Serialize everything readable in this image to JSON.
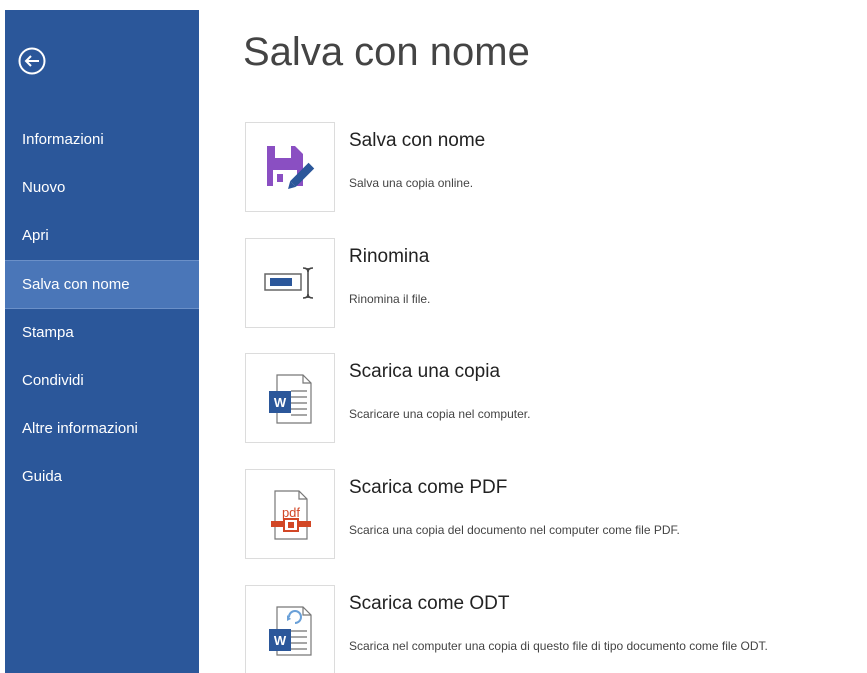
{
  "sidebar": {
    "back_icon": "back-arrow-circle-icon",
    "items": [
      {
        "label": "Informazioni",
        "active": false
      },
      {
        "label": "Nuovo",
        "active": false
      },
      {
        "label": "Apri",
        "active": false
      },
      {
        "label": "Salva con nome",
        "active": true
      },
      {
        "label": "Stampa",
        "active": false
      },
      {
        "label": "Condividi",
        "active": false
      },
      {
        "label": "Altre informazioni",
        "active": false
      },
      {
        "label": "Guida",
        "active": false
      }
    ]
  },
  "main": {
    "title": "Salva con nome",
    "options": [
      {
        "title": "Salva con nome",
        "description": "Salva una copia online.",
        "icon": "save-as-icon"
      },
      {
        "title": "Rinomina",
        "description": "Rinomina il file.",
        "icon": "rename-icon"
      },
      {
        "title": "Scarica una copia",
        "description": "Scaricare una copia nel computer.",
        "icon": "word-document-icon"
      },
      {
        "title": "Scarica come PDF",
        "description": "Scarica una copia del documento nel computer come file PDF.",
        "icon": "pdf-icon"
      },
      {
        "title": "Scarica come ODT",
        "description": "Scarica nel computer una copia di questo file di tipo documento come file ODT.",
        "icon": "odt-document-icon"
      }
    ]
  },
  "colors": {
    "sidebar_bg": "#2b579a",
    "sidebar_active": "#4a76b8",
    "save_icon": "#8a4fc2",
    "word_blue": "#2b579a",
    "pdf_red": "#d24726"
  }
}
